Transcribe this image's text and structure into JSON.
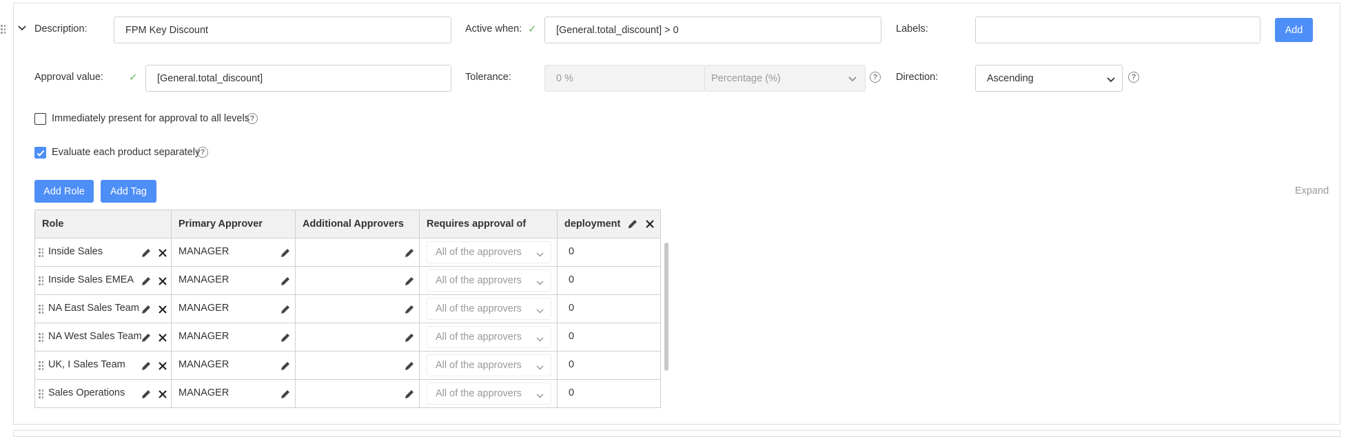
{
  "form": {
    "description_label": "Description:",
    "description_value": "FPM Key Discount",
    "active_when_label": "Active when:",
    "active_when_value": "[General.total_discount] > 0",
    "labels_label": "Labels:",
    "labels_value": "",
    "add_label": "Add",
    "approval_value_label": "Approval value:",
    "approval_value_value": "[General.total_discount]",
    "tolerance_label": "Tolerance:",
    "tolerance_value": "0 %",
    "tolerance_unit": "Percentage (%)",
    "direction_label": "Direction:",
    "direction_value": "Ascending",
    "immediately_present_label": "Immediately present for approval to all levels",
    "immediately_present_checked": false,
    "evaluate_each_label": "Evaluate each product separately",
    "evaluate_each_checked": true,
    "help_glyph": "?"
  },
  "toolbar": {
    "add_role_label": "Add Role",
    "add_tag_label": "Add Tag",
    "expand_label": "Expand"
  },
  "table": {
    "headers": {
      "role": "Role",
      "primary": "Primary Approver",
      "additional": "Additional Approvers",
      "requires": "Requires approval of",
      "deployment": "deployment"
    },
    "rows": [
      {
        "role": "Inside Sales",
        "primary": "MANAGER",
        "additional": "",
        "requires": "All of the approvers",
        "deployment": "0"
      },
      {
        "role": "Inside Sales EMEA",
        "primary": "MANAGER",
        "additional": "",
        "requires": "All of the approvers",
        "deployment": "0"
      },
      {
        "role": "NA East Sales Team",
        "primary": "MANAGER",
        "additional": "",
        "requires": "All of the approvers",
        "deployment": "0"
      },
      {
        "role": "NA West Sales Team",
        "primary": "MANAGER",
        "additional": "",
        "requires": "All of the approvers",
        "deployment": "0"
      },
      {
        "role": "UK, I Sales Team",
        "primary": "MANAGER",
        "additional": "",
        "requires": "All of the approvers",
        "deployment": "0"
      },
      {
        "role": "Sales Operations",
        "primary": "MANAGER",
        "additional": "",
        "requires": "All of the approvers",
        "deployment": "0"
      }
    ]
  },
  "icons": {
    "collapse": "chevron-down-icon",
    "edit": "pencil-icon",
    "delete": "close-icon",
    "drag": "drag-handle-icon",
    "valid": "checkmark-icon",
    "help": "help-circle-icon"
  },
  "colors": {
    "accent": "#4e8ef7",
    "valid": "#5cb85c",
    "header_bg": "#f1f1f1",
    "border": "#cfcfcf"
  }
}
